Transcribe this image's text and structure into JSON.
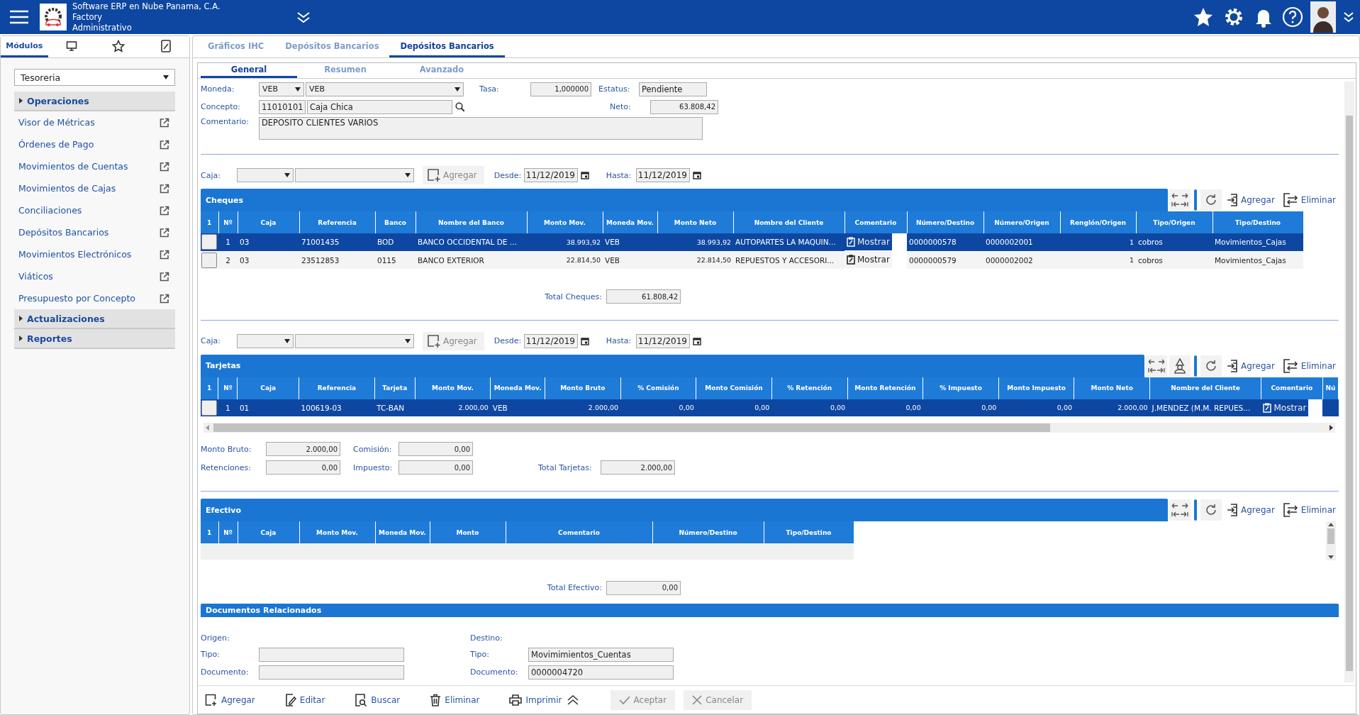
{
  "header": {
    "lines": [
      "Software ERP en Nube Panama, C.A.",
      "Factory",
      "Administrativo"
    ]
  },
  "sidebar": {
    "tabs": [
      {
        "kind": "label",
        "label": "Módulos",
        "selected": true
      },
      {
        "kind": "monitor",
        "selected": false
      },
      {
        "kind": "star",
        "selected": false
      },
      {
        "kind": "edit",
        "selected": false
      }
    ],
    "module": "Tesoreria",
    "sections": [
      {
        "title": "Operaciones",
        "items": [
          "Visor de Métricas",
          "Órdenes de Pago",
          "Movimientos de Cuentas",
          "Movimientos de Cajas",
          "Conciliaciones",
          "Depósitos Bancarios",
          "Movimientos Electrónicos",
          "Viáticos",
          "Presupuesto por Concepto"
        ]
      },
      {
        "title": "Actualizaciones"
      },
      {
        "title": "Reportes"
      }
    ]
  },
  "tabs": [
    {
      "label": "Gráficos IHC",
      "selected": false
    },
    {
      "label": "Depósitos Bancarios",
      "selected": false
    },
    {
      "label": "Depósitos Bancarios",
      "selected": true
    }
  ],
  "subtabs": [
    {
      "label": "General",
      "selected": true
    },
    {
      "label": "Resumen",
      "selected": false
    },
    {
      "label": "Avanzado",
      "selected": false
    }
  ],
  "form": {
    "moneda": {
      "label": "Moneda:",
      "code": "VEB",
      "name": "VEB"
    },
    "tasa": {
      "label": "Tasa:",
      "value": "1,000000"
    },
    "estatus": {
      "label": "Estatus:",
      "value": "Pendiente"
    },
    "concepto": {
      "label": "Concepto:",
      "code": "11010101",
      "name": "Caja Chica"
    },
    "neto": {
      "label": "Neto:",
      "value": "63.808,42"
    },
    "comentario": {
      "label": "Comentario:",
      "value": "DEPOSITO CLIENTES VARIOS"
    }
  },
  "cheques": {
    "filter": {
      "caja_label": "Caja:",
      "add": "Agregar",
      "desde_label": "Desde:",
      "desde": "11/12/2019",
      "hasta_label": "Hasta:",
      "hasta": "11/12/2019"
    },
    "title": "Cheques",
    "tools": [
      {
        "kind": "expand"
      },
      {
        "kind": "refresh"
      }
    ],
    "buttons": [
      {
        "kind": "add",
        "label": "Agregar"
      },
      {
        "kind": "remove",
        "label": "Eliminar"
      }
    ],
    "columns": [
      {
        "label": "1",
        "kind": "check"
      },
      {
        "label": "Nº",
        "kind": "index"
      },
      {
        "label": "Caja",
        "kind": "text"
      },
      {
        "label": "Referencia",
        "kind": "text"
      },
      {
        "label": "Banco",
        "kind": "text"
      },
      {
        "label": "Nombre del Banco",
        "kind": "text"
      },
      {
        "label": "Monto Mov.",
        "kind": "amount"
      },
      {
        "label": "Moneda Mov.",
        "kind": "text"
      },
      {
        "label": "Monto Neto",
        "kind": "amount"
      },
      {
        "label": "Nombre del Cliente",
        "kind": "text"
      },
      {
        "label": "Comentario",
        "kind": "note"
      },
      {
        "label": "Número/Destino",
        "kind": "text"
      },
      {
        "label": "Número/Origen",
        "kind": "text"
      },
      {
        "label": "Renglón/Origen",
        "kind": "amount"
      },
      {
        "label": "Tipo/Origen",
        "kind": "text"
      },
      {
        "label": "Tipo/Destino",
        "kind": "text"
      }
    ],
    "rows": [
      {
        "selected": true,
        "cells": [
          "",
          "1",
          "03",
          "71001435",
          "BOD",
          "BANCO OCCIDENTAL DE ...",
          "38.993,92",
          "VEB",
          "38.993,92",
          "AUTOPARTES LA MAQUIN...",
          "Mostrar",
          "0000000578",
          "0000002001",
          "1",
          "cobros",
          "Movimientos_Cajas"
        ]
      },
      {
        "selected": false,
        "cells": [
          "",
          "2",
          "03",
          "23512853",
          "0115",
          "BANCO EXTERIOR",
          "22.814,50",
          "VEB",
          "22.814,50",
          "REPUESTOS Y ACCESORI...",
          "Mostrar",
          "0000000579",
          "0000002002",
          "1",
          "cobros",
          "Movimientos_Cajas"
        ]
      }
    ],
    "total": {
      "label": "Total Cheques:",
      "value": "61.808,42"
    }
  },
  "tarjetas": {
    "filter": {
      "caja_label": "Caja:",
      "add": "Agregar",
      "desde_label": "Desde:",
      "desde": "11/12/2019",
      "hasta_label": "Hasta:",
      "hasta": "11/12/2019"
    },
    "title": "Tarjetas",
    "tools": [
      {
        "kind": "expand"
      },
      {
        "kind": "wizard"
      },
      {
        "kind": "refresh"
      }
    ],
    "buttons": [
      {
        "kind": "add",
        "label": "Agregar"
      },
      {
        "kind": "remove",
        "label": "Eliminar"
      }
    ],
    "columns": [
      {
        "label": "1",
        "kind": "check"
      },
      {
        "label": "Nº",
        "kind": "index"
      },
      {
        "label": "Caja",
        "kind": "text"
      },
      {
        "label": "Referencia",
        "kind": "text"
      },
      {
        "label": "Tarjeta",
        "kind": "text"
      },
      {
        "label": "Monto Mov.",
        "kind": "amount"
      },
      {
        "label": "Moneda Mov.",
        "kind": "text"
      },
      {
        "label": "Monto Bruto",
        "kind": "amount"
      },
      {
        "label": "% Comisión",
        "kind": "amount"
      },
      {
        "label": "Monto Comisión",
        "kind": "amount"
      },
      {
        "label": "% Retención",
        "kind": "amount"
      },
      {
        "label": "Monto Retención",
        "kind": "amount"
      },
      {
        "label": "% Impuesto",
        "kind": "amount"
      },
      {
        "label": "Monto Impuesto",
        "kind": "amount"
      },
      {
        "label": "Monto Neto",
        "kind": "amount"
      },
      {
        "label": "Nombre del Cliente",
        "kind": "text"
      },
      {
        "label": "Comentario",
        "kind": "note"
      },
      {
        "label": "Nú",
        "kind": "text"
      }
    ],
    "rows": [
      {
        "selected": true,
        "cells": [
          "",
          "1",
          "01",
          "100619-03",
          "TC-BAN",
          "2.000,00",
          "VEB",
          "2.000,00",
          "0,00",
          "0,00",
          "0,00",
          "0,00",
          "0,00",
          "0,00",
          "2.000,00",
          "J.MENDEZ (M.M. REPUES...",
          "Mostrar"
        ]
      }
    ],
    "summary": [
      [
        {
          "label": "Monto Bruto:",
          "value": "2.000,00"
        },
        {
          "label": "Comisión:",
          "value": "0,00"
        }
      ],
      [
        {
          "label": "Retenciones:",
          "value": "0,00"
        },
        {
          "label": "Impuesto:",
          "value": "0,00"
        },
        {
          "label": "Total Tarjetas:",
          "value": "2.000,00"
        }
      ]
    ]
  },
  "efectivo": {
    "title": "Efectivo",
    "tools": [
      {
        "kind": "expand"
      },
      {
        "kind": "refresh"
      }
    ],
    "buttons": [
      {
        "kind": "add",
        "label": "Agregar"
      },
      {
        "kind": "remove",
        "label": "Eliminar"
      }
    ],
    "columns": [
      {
        "label": "1"
      },
      {
        "label": "Nº"
      },
      {
        "label": "Caja"
      },
      {
        "label": "Monto Mov."
      },
      {
        "label": "Moneda Mov."
      },
      {
        "label": "Monto"
      },
      {
        "label": "Comentario"
      },
      {
        "label": "Número/Destino"
      },
      {
        "label": "Tipo/Destino"
      }
    ],
    "total": {
      "label": "Total Efectivo:",
      "value": "0,00"
    }
  },
  "documentos": {
    "title": "Documentos Relacionados",
    "origen": {
      "label": "Origen:",
      "tipo_label": "Tipo:",
      "documento_label": "Documento:"
    },
    "destino": {
      "label": "Destino:",
      "tipo_label": "Tipo:",
      "tipo": "Movimimientos_Cuentas",
      "documento_label": "Documento:",
      "documento": "0000004720"
    }
  },
  "actions": [
    {
      "kind": "add",
      "label": "Agregar",
      "disabled": false
    },
    {
      "kind": "edit",
      "label": "Editar",
      "disabled": false
    },
    {
      "kind": "search",
      "label": "Buscar",
      "disabled": false
    },
    {
      "kind": "delete",
      "label": "Eliminar",
      "disabled": false
    },
    {
      "kind": "print",
      "label": "Imprimir",
      "disabled": false
    },
    {
      "kind": "collapse",
      "disabled": false
    },
    {
      "kind": "accept",
      "label": "Aceptar",
      "disabled": true
    },
    {
      "kind": "cancel",
      "label": "Cancelar",
      "disabled": true
    }
  ]
}
